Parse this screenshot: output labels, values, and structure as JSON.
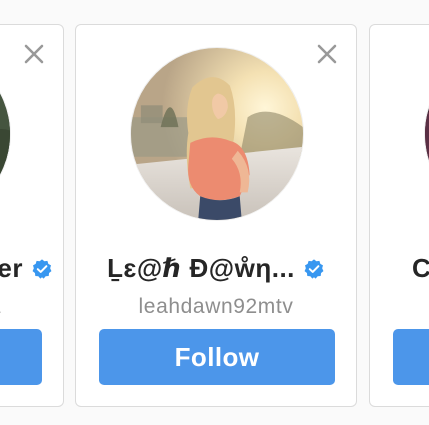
{
  "colors": {
    "background": "#fafafa",
    "card": "#ffffff",
    "border": "#dbdbdb",
    "accent": "#4c96ea",
    "name_text": "#262626",
    "username_text": "#8e8e8e",
    "close_icon": "#999999",
    "verified_badge": "#3897f0"
  },
  "cards": [
    {
      "position": "left-partial",
      "name": "er",
      "username": "a",
      "verified": true,
      "icons": {
        "close": "close-icon",
        "verified": "verified-badge-icon"
      }
    },
    {
      "position": "center",
      "name": "Ḻɛ@ℏ Đ@ẘη...",
      "username": "leahdawn92mtv",
      "verified": true,
      "follow_label": "Follow",
      "icons": {
        "close": "close-icon",
        "verified": "verified-badge-icon"
      }
    },
    {
      "position": "right-partial",
      "name": "C",
      "verified": false
    }
  ]
}
